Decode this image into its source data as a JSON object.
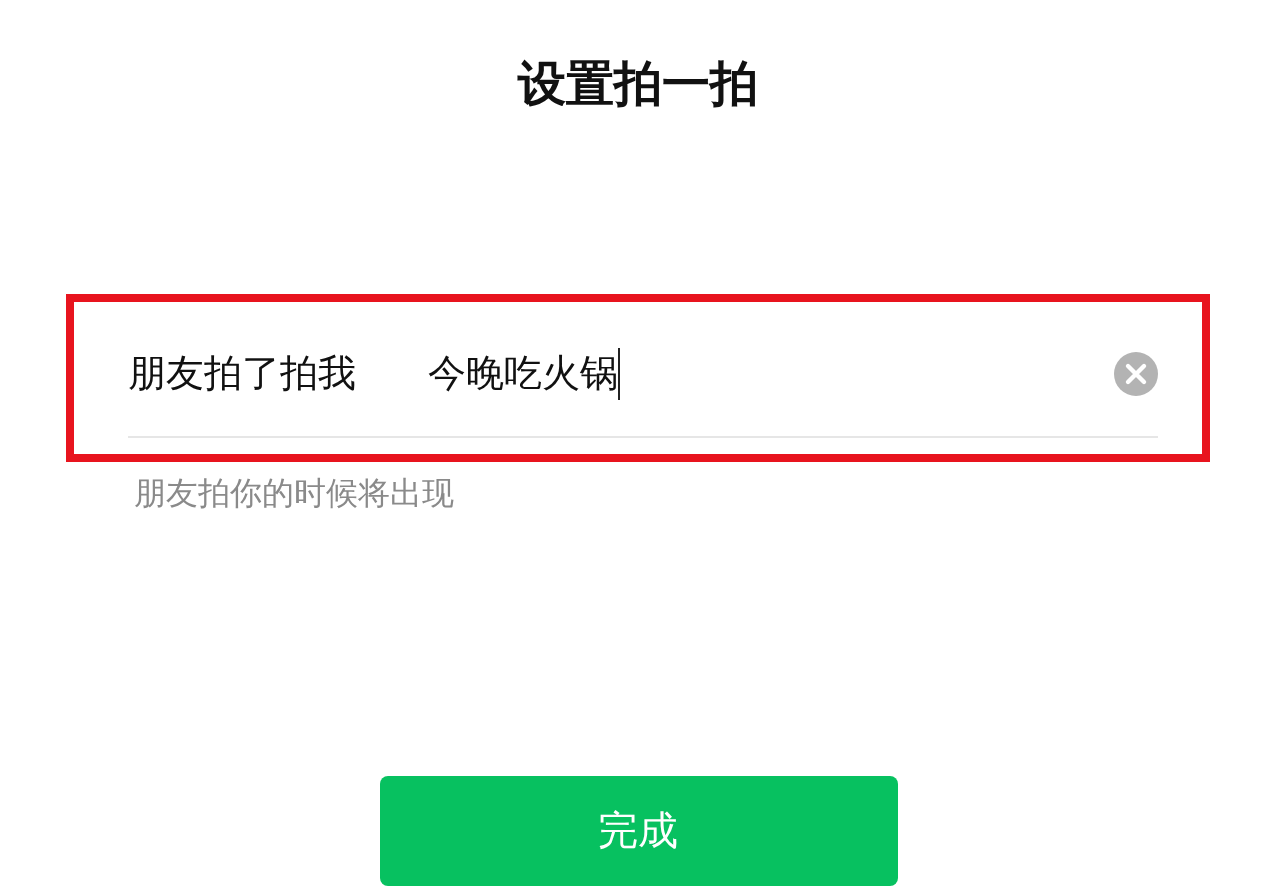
{
  "title": "设置拍一拍",
  "field": {
    "prefix": "朋友拍了拍我",
    "value": "今晚吃火锅",
    "highlighted": true
  },
  "hint": "朋友拍你的时候将出现",
  "button": {
    "label": "完成"
  }
}
